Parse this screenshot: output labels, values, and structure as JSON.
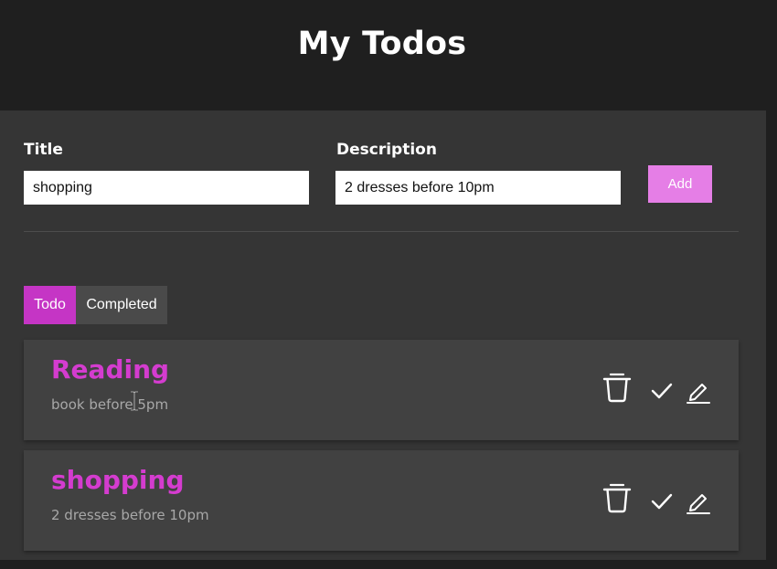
{
  "header": {
    "title": "My Todos"
  },
  "form": {
    "title_label": "Title",
    "title_value": "shopping",
    "description_label": "Description",
    "description_value": "2 dresses before 10pm",
    "add_label": "Add"
  },
  "tabs": [
    {
      "label": "Todo",
      "active": true
    },
    {
      "label": "Completed",
      "active": false
    }
  ],
  "todos": [
    {
      "title": "Reading",
      "description": "book before 5pm"
    },
    {
      "title": "shopping",
      "description": "2 dresses before 10pm"
    }
  ],
  "icons": {
    "delete": "trash-icon",
    "complete": "check-icon",
    "edit": "pencil-icon"
  },
  "colors": {
    "accent": "#e57ee6",
    "active_tab": "#c535c5",
    "todo_title": "#d43ccf",
    "panel": "#353535",
    "card": "#414141",
    "background": "#1f1f1f"
  }
}
